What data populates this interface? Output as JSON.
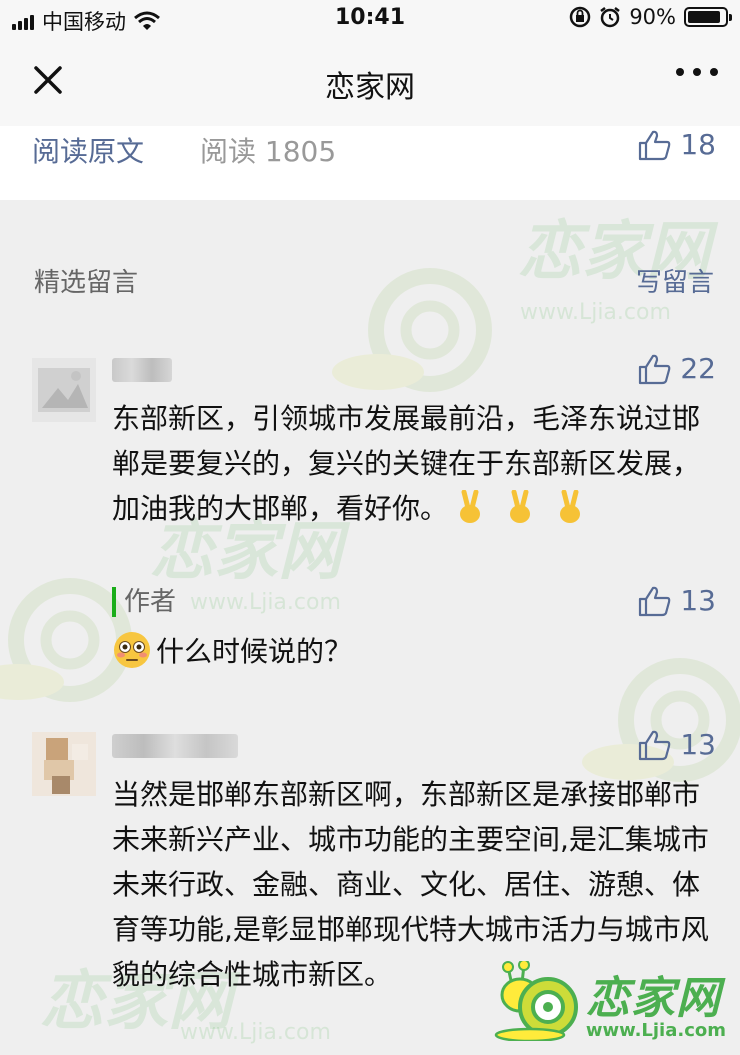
{
  "status_bar": {
    "carrier": "中国移动",
    "time": "10:41",
    "battery": "90%",
    "battery_level": 0.9,
    "icons": [
      "signal-icon",
      "wifi-icon",
      "rotation-lock-icon",
      "alarm-icon",
      "battery-icon"
    ]
  },
  "nav": {
    "title": "恋家网",
    "close_icon": "close-icon",
    "more_icon": "more-icon"
  },
  "article_meta": {
    "read_original": "阅读原文",
    "read_count": "阅读 1805",
    "likes": "18"
  },
  "comments_section": {
    "title": "精选留言",
    "write_label": "写留言",
    "comments": [
      {
        "text": "东部新区，引领城市发展最前沿，毛泽东说过邯郸是要复兴的，复兴的关键在于东部新区发展，加油我的大邯郸，看好你。",
        "emojis": [
          "victory-hand-emoji",
          "victory-hand-emoji",
          "victory-hand-emoji"
        ],
        "likes": "22",
        "reply": {
          "label": "作者",
          "emoji": "flushed-face-emoji",
          "text": "什么时候说的？",
          "likes": "13"
        }
      },
      {
        "text": "当然是邯郸东部新区啊，东部新区是承接邯郸市未来新兴产业、城市功能的主要空间,是汇集城市未来行政、金融、商业、文化、居住、游憩、体育等功能,是彰显邯郸现代特大城市活力与城市风貌的综合性城市新区。",
        "likes": "13"
      }
    ]
  },
  "watermark": {
    "text": "恋家网",
    "url": "www.Ljia.com"
  },
  "colors": {
    "link": "#576b95",
    "author_bar": "#1aad19",
    "watermark": "#4caf50",
    "page_bg": "#efefef"
  }
}
